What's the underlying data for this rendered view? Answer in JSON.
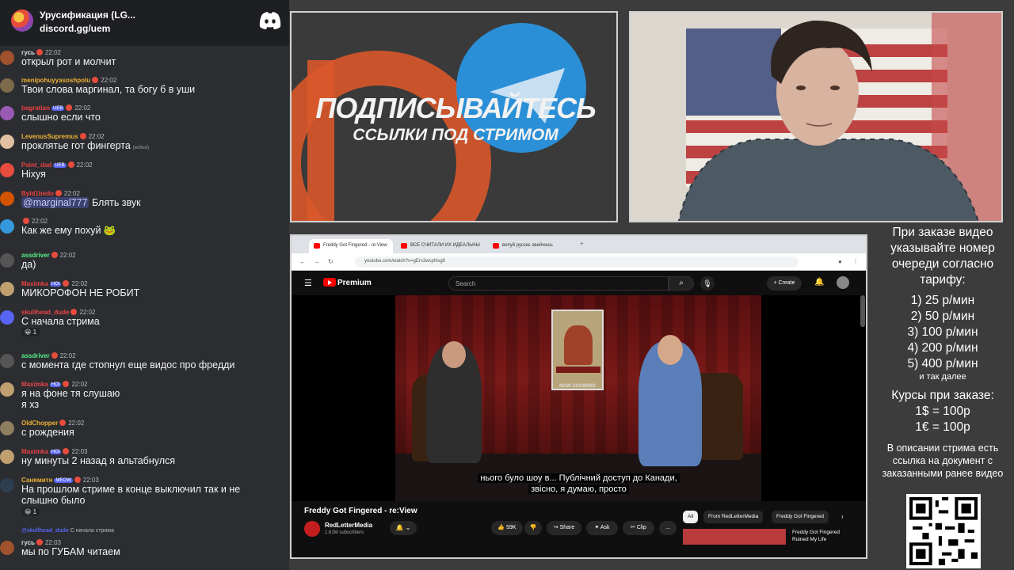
{
  "server": {
    "name": "Урусификация (LG...",
    "link": "discord.gg/uem"
  },
  "chat": [
    {
      "name": "гусь",
      "name_color": "#dbdee1",
      "time": "22:02",
      "text": "открыл рот и молчит",
      "avatar": "#a0522d"
    },
    {
      "name": "menipohuyyasoshpolu",
      "name_color": "#f0b232",
      "time": "22:02",
      "text": "Твои слова маргинал, та богу б в уши",
      "avatar": "#7c6a4a"
    },
    {
      "name": "bagratian",
      "name_color": "#ed4245",
      "badge": "UEB",
      "time": "22:02",
      "text": "слышно если что",
      "avatar": "#9b59b6"
    },
    {
      "name": "LevenusSupremus",
      "name_color": "#f0b232",
      "time": "22:02",
      "text": "проклятье гот фингерта",
      "edited": "(edited)",
      "avatar": "#e0c0a0"
    },
    {
      "name": "Paint_dad",
      "name_color": "#ed4245",
      "badge": "UEB",
      "time": "22:02",
      "text": "Ніхуя",
      "avatar": "#e74c3c"
    },
    {
      "name": "Byld1bedo",
      "name_color": "#ed4245",
      "time": "22:02",
      "mention": "@marginal777",
      "text": "Блять звук",
      "avatar": "#d35400"
    },
    {
      "name": "",
      "name_color": "#ed4245",
      "time": "22:02",
      "text": "Как же ему похуй",
      "emoji": "🐸",
      "avatar": "#3498db"
    },
    {
      "name": "assdriver",
      "name_color": "#57f287",
      "time": "22:02",
      "text": "да)",
      "avatar": "#555555"
    },
    {
      "name": "Maximka",
      "name_color": "#ed4245",
      "badge": "HOI",
      "time": "22:02",
      "text": "МИКОРОФОН НЕ РОБИТ",
      "avatar": "#c0a070"
    },
    {
      "name": "skullhead_dude",
      "name_color": "#ed4245",
      "time": "22:02",
      "text": "С начала стрима",
      "react": "1",
      "avatar": "#5865f2"
    },
    {
      "name": "assdriver",
      "name_color": "#57f287",
      "time": "22:02",
      "text": "с момента где стопнул еще видос про фредди",
      "avatar": "#555555"
    },
    {
      "name": "Maximka",
      "name_color": "#ed4245",
      "badge": "HOI",
      "time": "22:02",
      "text": "я на фоне тя слушаю",
      "text2": "я хз",
      "avatar": "#c0a070"
    },
    {
      "name": "OldChopper",
      "name_color": "#f0b232",
      "time": "22:02",
      "text": "с рождения",
      "avatar": "#8e7f5f"
    },
    {
      "name": "Maximka",
      "name_color": "#ed4245",
      "badge": "HOI",
      "time": "22:03",
      "text": "ну минуты 2 назад я альтабнулся",
      "avatar": "#c0a070"
    },
    {
      "name": "Санямитн",
      "name_color": "#f0b232",
      "badge": "MEOW",
      "time": "22:03",
      "text": "На прошлом стриме в конце выключил так и не слышно было",
      "react": "1",
      "avatar": "#2c3e50"
    },
    {
      "reply_to": "@skullhead_dude",
      "reply_text": "С начала стрима",
      "name": "гусь",
      "name_color": "#dbdee1",
      "time": "22:03",
      "text": "мы по ГУБАМ читаем",
      "avatar": "#a0522d"
    }
  ],
  "promo": {
    "line1": "ПОДПИСЫВАЙТЕСЬ",
    "line2": "ССЫЛКИ ПОД СТРИМОМ"
  },
  "browser": {
    "tabs": [
      "Freddy Got Fingered - re:View",
      "ВСЕ СЧИТАЛИ ИХ ИДЕАЛЬНЫ",
      "вопуй русскє эвейчюсь"
    ],
    "url": "youtube.com/watch?v=gErs3wcpNsg8"
  },
  "youtube": {
    "logo": "Premium",
    "search_placeholder": "Search",
    "create": "+ Create",
    "poster_caption": "NOW SHOWING",
    "subtitle_1": "нього було шоу в...  Публічний доступ до Канади,",
    "subtitle_2": "звісно, я думаю, просто",
    "title": "Freddy Got Fingered - re:View",
    "channel": "RedLetterMedia",
    "subscribers": "1.61M subscribers",
    "likes": "59K",
    "share": "Share",
    "ask": "Ask",
    "clip": "Clip",
    "more": "...",
    "chips": [
      "All",
      "From RedLetterMedia",
      "Freddy Got Fingered"
    ],
    "rec_title": "Freddy Got Fingered Ruined My Life"
  },
  "info": {
    "intro": "При заказе видео указывайте номер очереди согласно тарифу:",
    "tariffs": [
      "1) 25 р/мин",
      "2) 50 р/мин",
      "3) 100 р/мин",
      "4) 200 р/мин",
      "5) 400 р/мин"
    ],
    "and_more": "и так далее",
    "courses_title": "Курсы при заказе:",
    "rates": [
      "1$ = 100р",
      "1€ = 100р"
    ],
    "note": "В описании стрима есть ссылка на документ с заказанными ранее видео"
  },
  "colors": {
    "discord_bg": "#2b2d31",
    "yt_red": "#ff0000",
    "telegram_blue": "#2a8fd6",
    "patreon_orange": "#d9582b"
  }
}
